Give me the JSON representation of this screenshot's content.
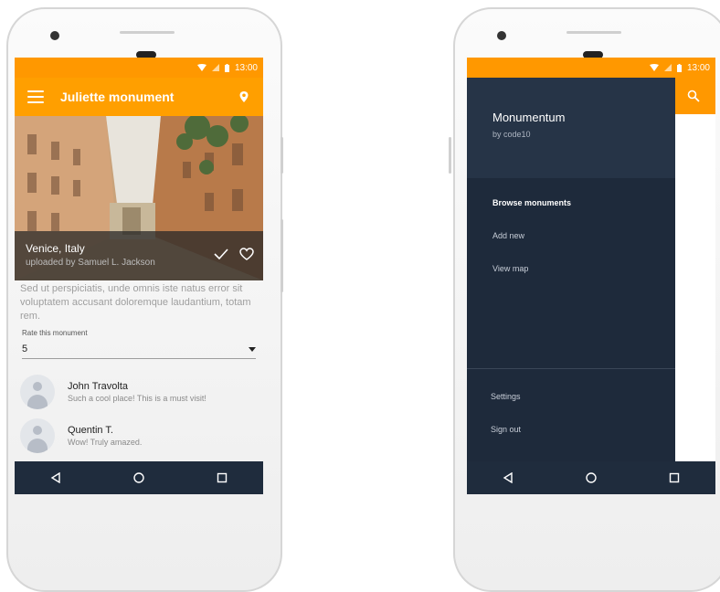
{
  "left_phone": {
    "status_time": "13:00",
    "appbar": {
      "title": "Juliette monument"
    },
    "hero": {
      "location": "Venice, Italy",
      "uploader": "uploaded by Samuel L. Jackson"
    },
    "description": "Sed ut perspiciatis, unde omnis iste natus error sit voluptatem accusant doloremque laudantium, totam rem.",
    "rating": {
      "label": "Rate this monument",
      "value": "5"
    },
    "comments": [
      {
        "name": "John Travolta",
        "message": "Such a cool place! This is a must visit!"
      },
      {
        "name": "Quentin T.",
        "message": "Wow! Truly amazed."
      }
    ]
  },
  "right_phone": {
    "status_time": "13:00",
    "drawer": {
      "title": "Monumentum",
      "subtitle": "by code10",
      "items": [
        "Browse monuments",
        "Add new",
        "View map"
      ],
      "bottom_items": [
        "Settings",
        "Sign out"
      ]
    }
  },
  "colors": {
    "accent": "#ff9800",
    "drawer": "#1e2a3b",
    "navbar": "#1f2c3d"
  },
  "icons": [
    "menu-icon",
    "location-pin-icon",
    "check-icon",
    "heart-icon",
    "search-icon",
    "back-icon",
    "home-icon",
    "recents-icon",
    "wifi-icon",
    "signal-icon",
    "battery-icon"
  ]
}
